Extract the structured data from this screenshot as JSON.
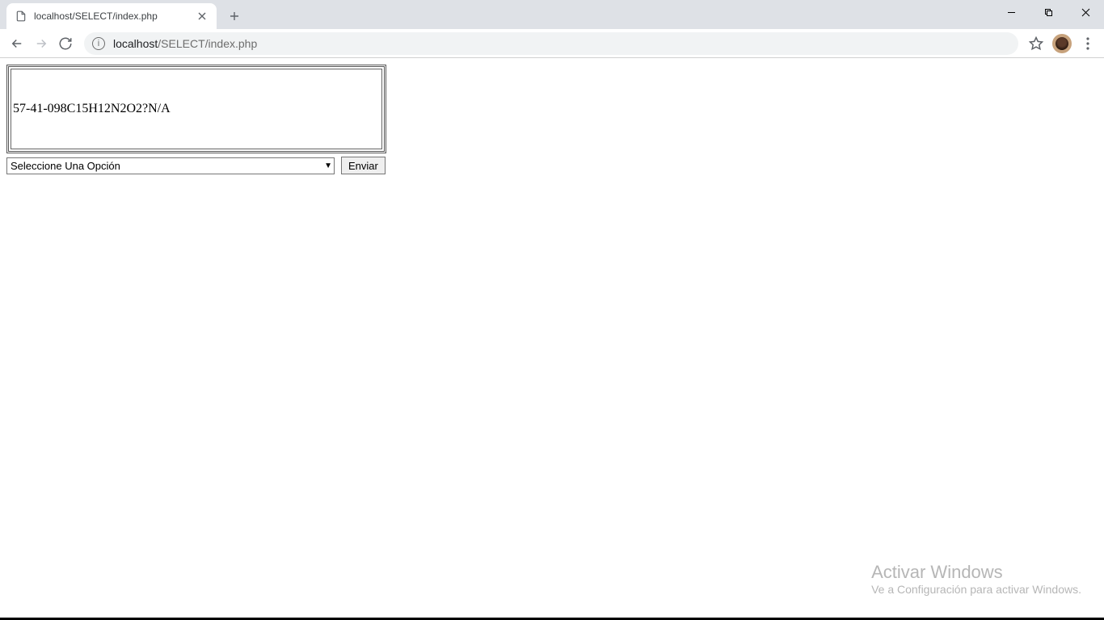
{
  "browser": {
    "tab_title": "localhost/SELECT/index.php",
    "url_host": "localhost",
    "url_path": "/SELECT/index.php"
  },
  "content": {
    "table_cell": "57-41-098C15H12N2O2?N/A",
    "select_placeholder": "Seleccione Una Opción",
    "submit_label": "Enviar"
  },
  "watermark": {
    "title": "Activar Windows",
    "subtitle": "Ve a Configuración para activar Windows."
  }
}
